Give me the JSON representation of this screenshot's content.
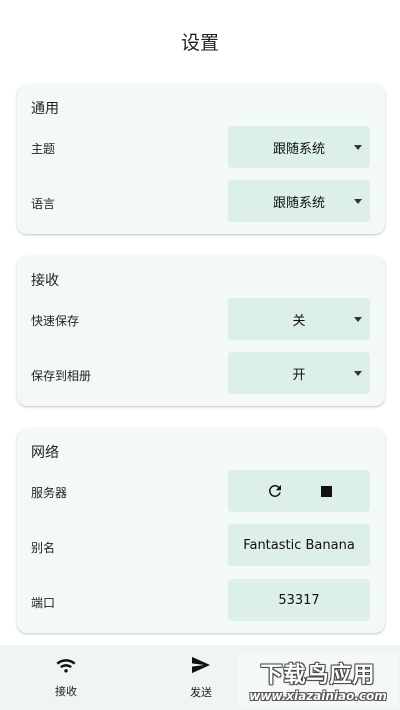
{
  "page": {
    "title": "设置"
  },
  "general": {
    "title": "通用",
    "theme": {
      "label": "主题",
      "value": "跟随系统"
    },
    "language": {
      "label": "语言",
      "value": "跟随系统"
    }
  },
  "receive": {
    "title": "接收",
    "quick_save": {
      "label": "快速保存",
      "value": "关"
    },
    "save_to_album": {
      "label": "保存到相册",
      "value": "开"
    }
  },
  "network": {
    "title": "网络",
    "server": {
      "label": "服务器",
      "restart_icon": "refresh-icon",
      "stop_icon": "stop-icon"
    },
    "alias": {
      "label": "别名",
      "value": "Fantastic Banana"
    },
    "port": {
      "label": "端口",
      "value": "53317"
    }
  },
  "bottom_nav": {
    "items": [
      {
        "label": "接收",
        "icon": "wifi-icon"
      },
      {
        "label": "发送",
        "icon": "send-icon"
      }
    ]
  },
  "watermark": {
    "main": "下载鸟应用",
    "sub": "www.xiazainiao.com"
  },
  "colors": {
    "card_bg": "#f3f9f7",
    "control_bg": "#dcefea",
    "nav_bg": "#eef5f2"
  }
}
